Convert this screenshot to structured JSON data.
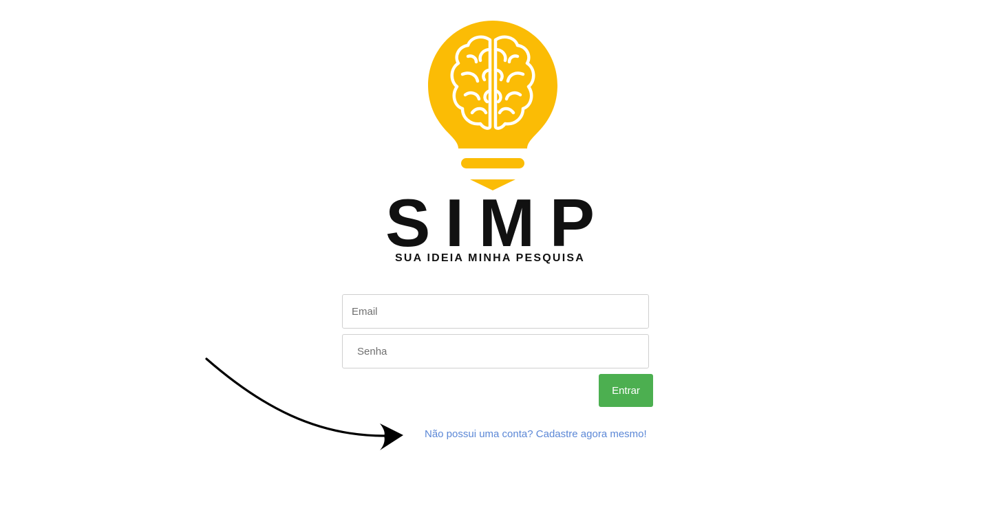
{
  "brand": {
    "name_letters": [
      "S",
      "I",
      "M",
      "P"
    ],
    "tagline": "SUA IDEIA MINHA PESQUISA",
    "primary_color": "#fbbc05",
    "text_color": "#111111"
  },
  "login": {
    "email_placeholder": "Email",
    "password_placeholder": "Senha",
    "submit_label": "Entrar",
    "submit_color": "#4caf50",
    "signup_link": "Não possui uma conta? Cadastre agora mesmo!",
    "link_color": "#5b87d6"
  },
  "annotation": {
    "icon": "curved-arrow-icon"
  }
}
